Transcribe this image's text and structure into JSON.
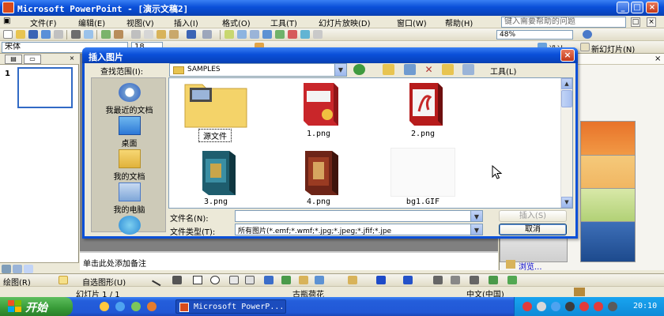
{
  "window": {
    "title": "Microsoft PowerPoint - [演示文稿2]"
  },
  "menu": {
    "items": [
      "文件(F)",
      "编辑(E)",
      "视图(V)",
      "插入(I)",
      "格式(O)",
      "工具(T)",
      "幻灯片放映(D)",
      "窗口(W)",
      "帮助(H)"
    ],
    "help_placeholder": "键入需要帮助的问题"
  },
  "toolbar": {
    "zoom": "48%",
    "font": "宋体",
    "font_size": "18",
    "design_label": "设计",
    "new_slide_label": "新幻灯片(N)"
  },
  "outline": {
    "slide_number": "1"
  },
  "notes": {
    "placeholder": "单击此处添加备注"
  },
  "taskpane": {
    "browse_link": "浏览..."
  },
  "drawbar": {
    "draw_label": "绘图(R)",
    "autoshapes_label": "自选图形(U)"
  },
  "status": {
    "slide": "幻灯片 1 / 1",
    "design": "古瓶荷花",
    "language": "中文(中国)"
  },
  "taskbar": {
    "start": "开始",
    "task_item": "Microsoft PowerP...",
    "clock": "20:10"
  },
  "dialog": {
    "title": "插入图片",
    "look_in_label": "查找范围(I):",
    "look_in_value": "SAMPLES",
    "tools_label": "工具(L)",
    "places": [
      "我最近的文档",
      "桌面",
      "我的文档",
      "我的电脑"
    ],
    "files": [
      {
        "name": "源文件",
        "kind": "folder"
      },
      {
        "name": "1.png",
        "kind": "red-box"
      },
      {
        "name": "2.png",
        "kind": "flash-box"
      },
      {
        "name": "3.png",
        "kind": "teal-box"
      },
      {
        "name": "4.png",
        "kind": "brown-box"
      },
      {
        "name": "bg1.GIF",
        "kind": "blank"
      }
    ],
    "filename_label": "文件名(N):",
    "filename_value": "",
    "filetype_label": "文件类型(T):",
    "filetype_value": "所有图片(*.emf;*.wmf;*.jpg;*.jpeg;*.jfif;*.jpe",
    "insert_button": "插入(S)",
    "cancel_button": "取消"
  },
  "colors": {
    "xp_blue": "#0a4fd8",
    "start_green": "#379a37",
    "dialog_face": "#ece9d8"
  }
}
